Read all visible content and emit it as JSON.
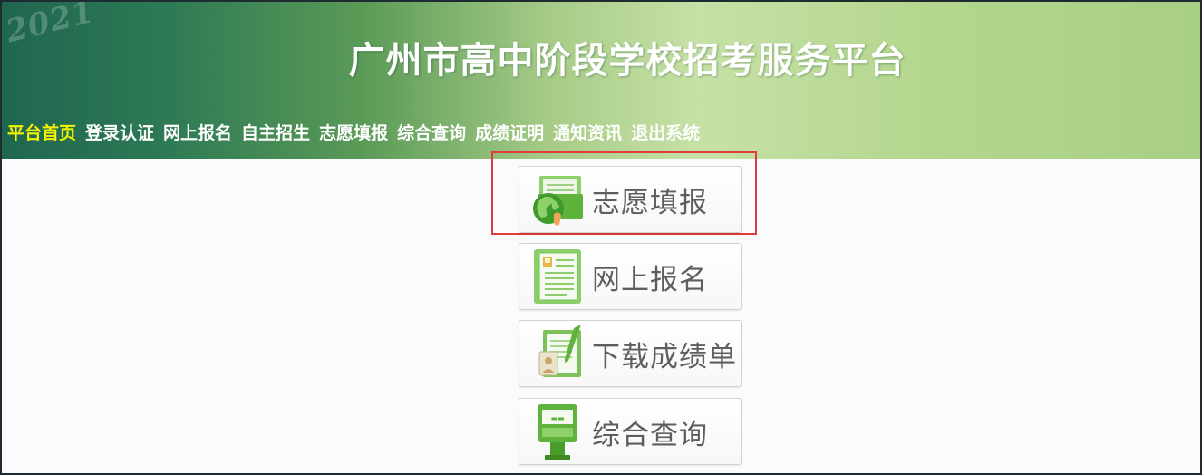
{
  "header": {
    "watermark": "2021",
    "title": "广州市高中阶段学校招考服务平台"
  },
  "nav": {
    "items": [
      {
        "label": "平台首页",
        "active": true
      },
      {
        "label": "登录认证"
      },
      {
        "label": "网上报名"
      },
      {
        "label": "自主招生"
      },
      {
        "label": "志愿填报"
      },
      {
        "label": "综合查询"
      },
      {
        "label": "成绩证明"
      },
      {
        "label": "通知资讯"
      },
      {
        "label": "退出系统"
      }
    ]
  },
  "menu": {
    "buttons": [
      {
        "label": "志愿填报",
        "icon": "globe-folder-icon",
        "highlighted": true
      },
      {
        "label": "网上报名",
        "icon": "registration-form-icon"
      },
      {
        "label": "下载成绩单",
        "icon": "score-report-icon"
      },
      {
        "label": "综合查询",
        "icon": "query-terminal-icon"
      }
    ]
  },
  "colors": {
    "accent_green": "#6cc24a",
    "active_nav": "#f4f400",
    "highlight_border": "#e23b3b"
  }
}
